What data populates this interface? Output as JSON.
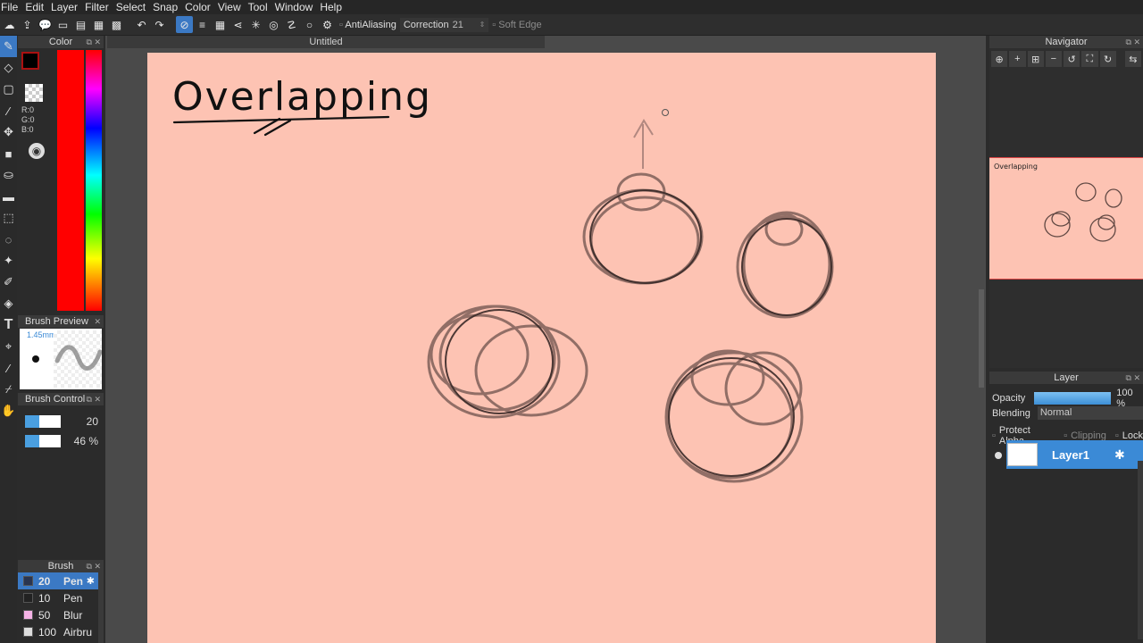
{
  "menu": [
    "File",
    "Edit",
    "Layer",
    "Filter",
    "Select",
    "Snap",
    "Color",
    "View",
    "Tool",
    "Window",
    "Help"
  ],
  "toolbar": {
    "antialiasing_label": "AntiAliasing",
    "correction_label": "Correction",
    "correction_value": "21",
    "soft_edge_label": "Soft Edge"
  },
  "document": {
    "tab_title": "Untitled"
  },
  "color_panel": {
    "title": "Color",
    "rgb": "R:0\nG:0\nB:0",
    "fg_color": "#000000",
    "hue_color": "#ff0000"
  },
  "brush_preview": {
    "title": "Brush Preview",
    "size": "1.45mm"
  },
  "brush_control": {
    "title": "Brush Control",
    "size_value": "20",
    "opacity_value": "46 %"
  },
  "brush_panel": {
    "title": "Brush",
    "items": [
      {
        "num": "20",
        "name": "Pen",
        "color": "#2a3550",
        "selected": true
      },
      {
        "num": "10",
        "name": "Pen",
        "color": "#222222",
        "selected": false
      },
      {
        "num": "50",
        "name": "Blur",
        "color": "#f5b3e6",
        "selected": false
      },
      {
        "num": "100",
        "name": "Airbru",
        "color": "#dddddd",
        "selected": false
      }
    ]
  },
  "canvas": {
    "handwritten_title": "Overlapping",
    "paper_color": "#fdc3b3"
  },
  "navigator": {
    "title": "Navigator",
    "thumbnail_text": "Overlapping"
  },
  "layer_panel": {
    "title": "Layer",
    "opacity_label": "Opacity",
    "opacity_value": "100 %",
    "opacity_fraction": 1.0,
    "blending_label": "Blending",
    "blending_value": "Normal",
    "protect_alpha_label": "Protect Alpha",
    "clipping_label": "Clipping",
    "lock_label": "Lock",
    "layers": [
      {
        "name": "Layer1",
        "visible": true,
        "selected": true
      }
    ]
  },
  "colors": {
    "accent": "#3b79c4",
    "paper": "#fdc3b3",
    "stroke": "#3a2a28"
  }
}
